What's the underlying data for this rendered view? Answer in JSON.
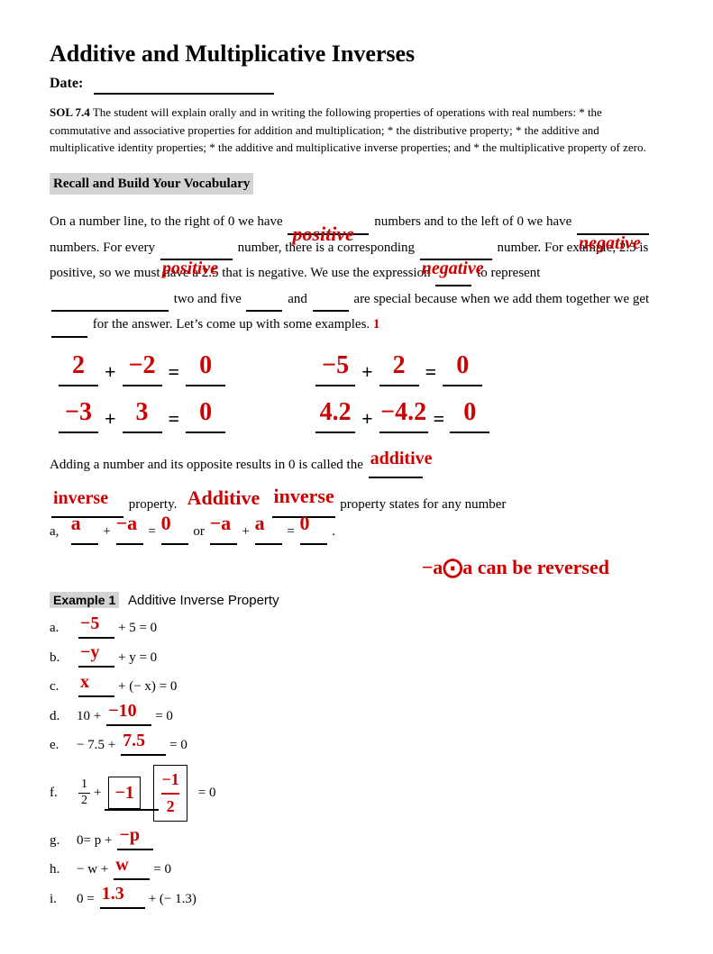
{
  "title": "Additive and Multiplicative Inverses",
  "date_label": "Date:",
  "sol": {
    "code": "SOL 7.4",
    "text": "The student will explain orally and in writing the following properties of operations with real numbers:  * the commutative and associative properties for addition and multiplication; * the distributive property; * the additive and multiplicative identity properties; * the additive and multiplicative inverse properties; and * the multiplicative property of zero."
  },
  "vocab_header": "Recall and Build Your Vocabulary",
  "body1": "On a number line, to the right of 0 we have",
  "hw_positive1": "positive",
  "body1b": "numbers and to the left of 0 we have",
  "hw_negative1": "negative",
  "body1c": "numbers.   For every",
  "hw_positive2": "positive",
  "body1d": "number, there is a corresponding",
  "hw_negative2": "negative",
  "body1e": "number.  For example, 2.5 is positive, so we must have a 2.5 that is negative.  We use the expression",
  "blank1": "",
  "body1f": "to represent",
  "blank2": "",
  "body1g": "two and five",
  "blank3": "",
  "body1h": "and",
  "blank4": "",
  "body1i": "are special because when we add them together we get",
  "blank5": "",
  "body1j": "for the answer.  Let’s come up with some examples.",
  "examples": {
    "left": [
      {
        "a": "2",
        "op1": "+",
        "b": "−2",
        "eq": "=",
        "ans": "0"
      },
      {
        "a": "−3",
        "op1": "+",
        "b": "3",
        "eq": "=",
        "ans": "0"
      }
    ],
    "right": [
      {
        "a": "−5",
        "op1": "+",
        "b": "2",
        "eq": "=",
        "ans": "0"
      },
      {
        "a": "4.2",
        "op1": "+",
        "b": "−4.2",
        "eq": "=",
        "ans": "0"
      }
    ]
  },
  "body2a": "Adding a number and its opposite results in 0 is called the",
  "hw_additive1": "additive",
  "hw_inverse1": "inverse",
  "body2b": "property.",
  "hw_additive2": "Additive",
  "hw_inverse2": "inverse",
  "body2c": "property states for any number",
  "body2d": "a,",
  "hw_a1": "a",
  "body2e": "+",
  "hw_nega1": "−a",
  "body2f": "=",
  "hw_zero1": "0",
  "body2g": "or",
  "hw_nega2": "−a",
  "body2h": "+",
  "hw_a2": "a",
  "body2i": "=",
  "hw_zero2": "0",
  "note": "−a⨀a can be reversed",
  "example1_label": "Example 1",
  "example1_title": "Additive Inverse Property",
  "rows": [
    {
      "letter": "a.",
      "prefix": "",
      "hw": "−5",
      "suffix": "+ 5 = 0"
    },
    {
      "letter": "b.",
      "prefix": "",
      "hw": "−y",
      "suffix": "+ y = 0"
    },
    {
      "letter": "c.",
      "prefix": "",
      "hw": "x",
      "suffix": "+ (− x) = 0"
    },
    {
      "letter": "d.",
      "prefix": "10 +",
      "hw": "−10",
      "suffix": "= 0"
    },
    {
      "letter": "e.",
      "prefix": "− 7.5 +",
      "hw": "7.5",
      "suffix": "= 0"
    },
    {
      "letter": "f.",
      "is_fraction": true,
      "hw": "−1",
      "suffix": "= 0"
    },
    {
      "letter": "g.",
      "prefix": "0= p +",
      "hw": "−p",
      "suffix": ""
    },
    {
      "letter": "h.",
      "prefix": "− w +",
      "hw": "w",
      "suffix": "= 0"
    },
    {
      "letter": "i.",
      "prefix": "0 =",
      "hw": "1.3",
      "suffix": "+ (− 1.3)"
    }
  ]
}
